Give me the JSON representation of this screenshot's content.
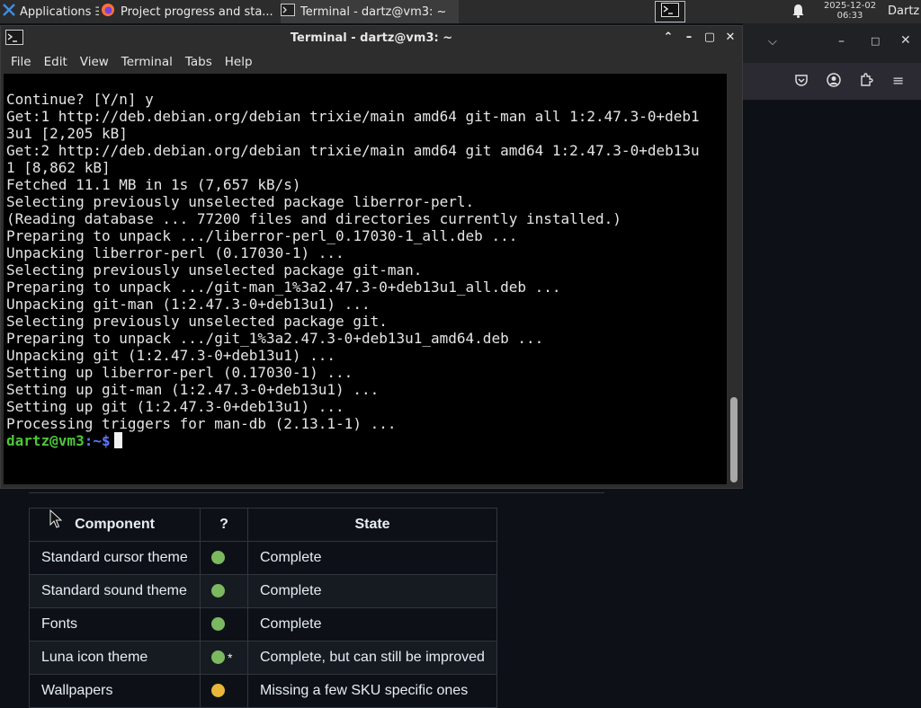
{
  "panel": {
    "applications_label": "Applications",
    "tasks": [
      {
        "label": "Project progress and sta...",
        "icon": "firefox-icon"
      },
      {
        "label": "Terminal - dartz@vm3: ~",
        "icon": "terminal-icon"
      }
    ],
    "clock_date": "2025-12-02",
    "clock_time": "06:33",
    "user": "Dartz"
  },
  "terminal": {
    "title": "Terminal - dartz@vm3: ~",
    "menu": [
      "File",
      "Edit",
      "View",
      "Terminal",
      "Tabs",
      "Help"
    ],
    "output": [
      "Continue? [Y/n] y",
      "Get:1 http://deb.debian.org/debian trixie/main amd64 git-man all 1:2.47.3-0+deb1",
      "3u1 [2,205 kB]",
      "Get:2 http://deb.debian.org/debian trixie/main amd64 git amd64 1:2.47.3-0+deb13u",
      "1 [8,862 kB]",
      "Fetched 11.1 MB in 1s (7,657 kB/s)",
      "Selecting previously unselected package liberror-perl.",
      "(Reading database ... 77200 files and directories currently installed.)",
      "Preparing to unpack .../liberror-perl_0.17030-1_all.deb ...",
      "Unpacking liberror-perl (0.17030-1) ...",
      "Selecting previously unselected package git-man.",
      "Preparing to unpack .../git-man_1%3a2.47.3-0+deb13u1_all.deb ...",
      "Unpacking git-man (1:2.47.3-0+deb13u1) ...",
      "Selecting previously unselected package git.",
      "Preparing to unpack .../git_1%3a2.47.3-0+deb13u1_amd64.deb ...",
      "Unpacking git (1:2.47.3-0+deb13u1) ...",
      "Setting up liberror-perl (0.17030-1) ...",
      "Setting up git-man (1:2.47.3-0+deb13u1) ...",
      "Setting up git (1:2.47.3-0+deb13u1) ...",
      "Processing triggers for man-db (2.13.1-1) ..."
    ],
    "prompt_user": "dartz@vm3",
    "prompt_path": ":~$"
  },
  "status_table": {
    "headers": [
      "Component",
      "?",
      "State"
    ],
    "rows": [
      {
        "component": "Standard cursor theme",
        "status": "green",
        "note": "",
        "state": "Complete"
      },
      {
        "component": "Standard sound theme",
        "status": "green",
        "note": "",
        "state": "Complete"
      },
      {
        "component": "Fonts",
        "status": "green",
        "note": "",
        "state": "Complete"
      },
      {
        "component": "Luna icon theme",
        "status": "green",
        "note": "*",
        "state": "Complete, but can still be improved"
      },
      {
        "component": "Wallpapers",
        "status": "yellow",
        "note": "",
        "state": "Missing a few SKU specific ones"
      }
    ]
  },
  "colors": {
    "green": "#7cb860",
    "yellow": "#e8b739",
    "page_bg": "#0d1117",
    "terminal_bg": "#000000",
    "prompt_user": "#4cc738",
    "prompt_path": "#5c78ff"
  }
}
